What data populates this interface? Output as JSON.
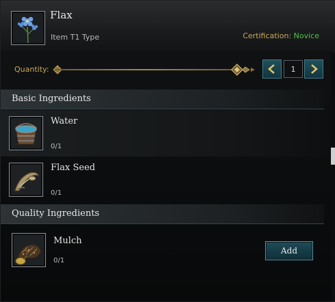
{
  "item": {
    "name": "Flax",
    "type_text": "Item T1 Type",
    "certification_label": "Certification:",
    "certification_level": "Novice",
    "icon": "flax-flower-icon"
  },
  "quantity": {
    "label": "Quantity:",
    "value": "1",
    "slider_value": 1
  },
  "basic_section": {
    "title": "Basic Ingredients",
    "items": [
      {
        "name": "Water",
        "count": "0/1",
        "icon": "water-bucket-icon"
      },
      {
        "name": "Flax Seed",
        "count": "0/1",
        "icon": "flax-seed-icon"
      }
    ]
  },
  "quality_section": {
    "title": "Quality Ingredients",
    "items": [
      {
        "name": "Mulch",
        "count": "0/1",
        "icon": "mulch-icon",
        "button": "Add"
      }
    ]
  },
  "colors": {
    "gold": "#c8a85a",
    "novice_green": "#4ac24a",
    "button_teal": "#1f4b57"
  }
}
